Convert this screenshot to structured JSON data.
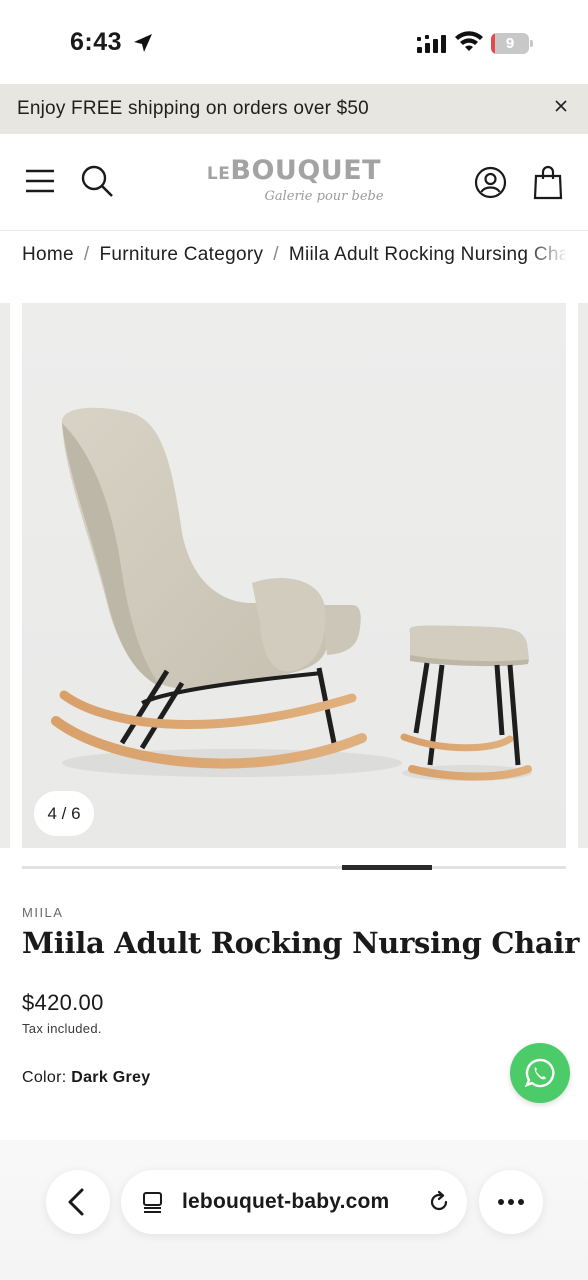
{
  "status_bar": {
    "time": "6:43",
    "battery_level": "9",
    "battery_fraction": 0.09,
    "icons": [
      "location-arrow-icon",
      "cellular-signal-icon",
      "wifi-icon",
      "battery-icon"
    ]
  },
  "announcement": {
    "text": "Enjoy FREE shipping on orders over $50",
    "close_icon": "close-icon"
  },
  "header": {
    "logo_main_prefix": "LE",
    "logo_main_rest": "BOUQUET",
    "logo_subtitle": "Galerie pour bebe",
    "icons": [
      "hamburger-menu-icon",
      "search-icon",
      "account-icon",
      "shopping-bag-icon"
    ]
  },
  "breadcrumb": {
    "items": [
      "Home",
      "Furniture Category",
      "Miila Adult Rocking Nursing Chair"
    ],
    "separator": "/"
  },
  "gallery": {
    "counter": "4 / 6",
    "current": 4,
    "total": 6,
    "image_description_icon": "product-photo"
  },
  "product": {
    "vendor": "MIILA",
    "title": "Miila Adult Rocking Nursing Chair",
    "price": "$420.00",
    "tax_note": "Tax included.",
    "color_label": "Color:",
    "color_value": "Dark Grey"
  },
  "floating": {
    "whatsapp_icon": "whatsapp-icon",
    "color": "#4ccb69"
  },
  "browser": {
    "url": "lebouquet-baby.com",
    "icons": [
      "back-arrow-icon",
      "tabs-icon",
      "reload-icon",
      "more-icon"
    ]
  }
}
